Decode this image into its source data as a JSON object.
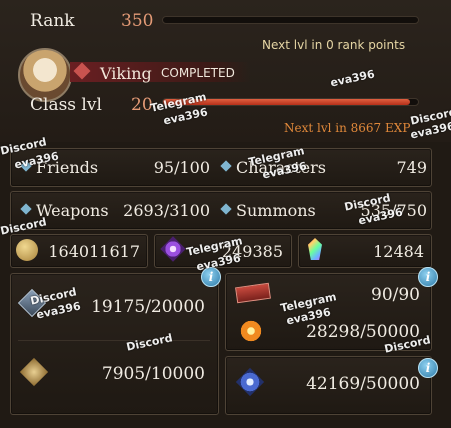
{
  "rank": {
    "label": "Rank",
    "value": "350",
    "progress": 0.0,
    "note": "Next lvl in 0 rank points"
  },
  "job": {
    "name": "Viking",
    "status": "COMPLETED"
  },
  "class_level": {
    "label": "Class lvl",
    "value": "20",
    "progress": 0.97,
    "note": "Next lvl in 8667 EXP"
  },
  "friends": {
    "label": "Friends",
    "value": "95/100"
  },
  "characters": {
    "label": "Characters",
    "value": "749"
  },
  "weapons": {
    "label": "Weapons",
    "value": "2693/3100"
  },
  "summons": {
    "label": "Summons",
    "value": "535/750"
  },
  "currency": {
    "rupies": "164011617",
    "crystals": "249385",
    "jewels": "12484"
  },
  "stock": {
    "left_top": "19175/20000",
    "left_bottom": "7905/10000",
    "right_top": "90/90",
    "right_mid": "28298/50000",
    "right_bottom": "42169/50000"
  },
  "colors": {
    "accent": "#e0883a",
    "rank_value": "#e39a76",
    "bar_fill": "#c83a20",
    "diamond": "#7fb5d0"
  },
  "watermarks": [
    "Telegram",
    "eva396",
    "Discord"
  ]
}
